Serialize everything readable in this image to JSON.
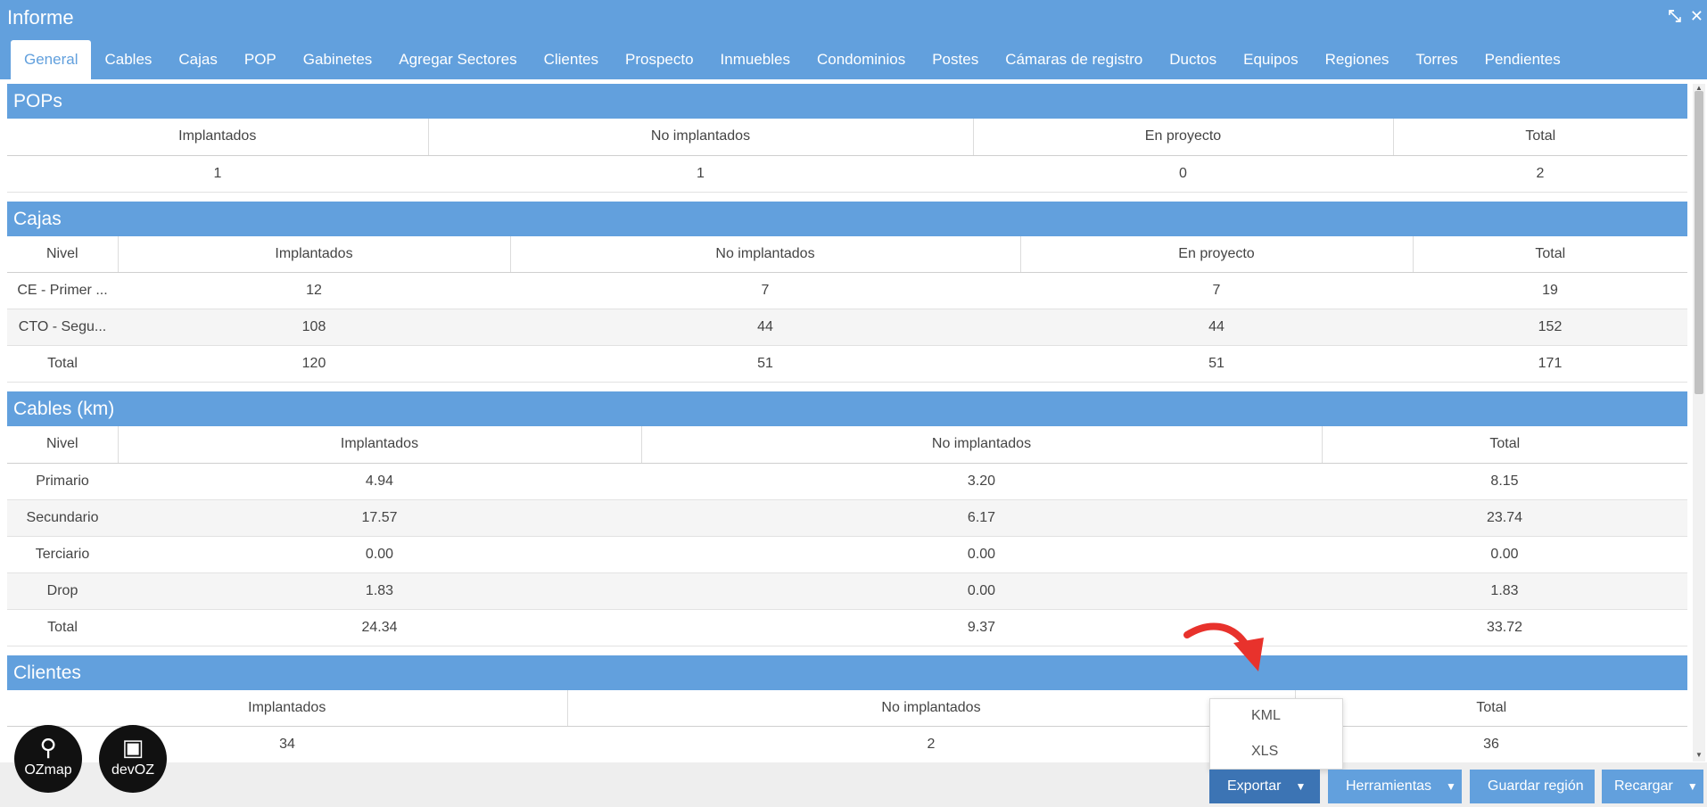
{
  "window": {
    "title": "Informe"
  },
  "tabs": [
    "General",
    "Cables",
    "Cajas",
    "POP",
    "Gabinetes",
    "Agregar Sectores",
    "Clientes",
    "Prospecto",
    "Inmuebles",
    "Condominios",
    "Postes",
    "Cámaras de registro",
    "Ductos",
    "Equipos",
    "Regiones",
    "Torres",
    "Pendientes"
  ],
  "pops": {
    "title": "POPs",
    "headers": [
      "Implantados",
      "No implantados",
      "En proyecto",
      "Total"
    ],
    "values": [
      "1",
      "1",
      "0",
      "2"
    ]
  },
  "cajas": {
    "title": "Cajas",
    "headers": [
      "Nivel",
      "Implantados",
      "No implantados",
      "En proyecto",
      "Total"
    ],
    "rows": [
      [
        "CE - Primer ...",
        "12",
        "7",
        "7",
        "19"
      ],
      [
        "CTO - Segu...",
        "108",
        "44",
        "44",
        "152"
      ],
      [
        "Total",
        "120",
        "51",
        "51",
        "171"
      ]
    ]
  },
  "cables": {
    "title": "Cables (km)",
    "headers": [
      "Nivel",
      "Implantados",
      "No implantados",
      "Total"
    ],
    "rows": [
      [
        "Primario",
        "4.94",
        "3.20",
        "8.15"
      ],
      [
        "Secundario",
        "17.57",
        "6.17",
        "23.74"
      ],
      [
        "Terciario",
        "0.00",
        "0.00",
        "0.00"
      ],
      [
        "Drop",
        "1.83",
        "0.00",
        "1.83"
      ],
      [
        "Total",
        "24.34",
        "9.37",
        "33.72"
      ]
    ]
  },
  "clientes": {
    "title": "Clientes",
    "headers": [
      "Implantados",
      "No implantados",
      "Total"
    ],
    "values": [
      "34",
      "2",
      "36"
    ]
  },
  "logos": {
    "ozmap": "OZmap",
    "devoz": "devOZ"
  },
  "buttons": {
    "export": "Exportar",
    "tools": "Herramientas",
    "save_region": "Guardar región",
    "reload": "Recargar"
  },
  "export_menu": {
    "options": [
      "KML",
      "XLS"
    ]
  },
  "colors": {
    "accent": "#62a0dd",
    "active_button": "#3c74b4",
    "annotation": "#e8322c"
  }
}
